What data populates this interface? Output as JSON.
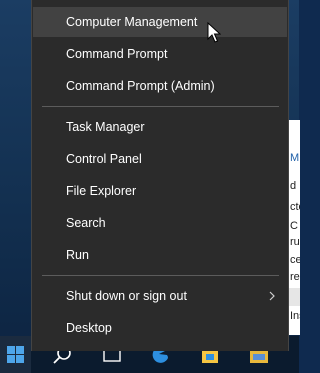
{
  "menu": {
    "items": [
      {
        "label": "Computer Management"
      },
      {
        "label": "Command Prompt"
      },
      {
        "label": "Command Prompt (Admin)"
      },
      {
        "label": "Task Manager"
      },
      {
        "label": "Control Panel"
      },
      {
        "label": "File Explorer"
      },
      {
        "label": "Search"
      },
      {
        "label": "Run"
      },
      {
        "label": "Shut down or sign out"
      },
      {
        "label": "Desktop"
      }
    ]
  },
  "background_window": {
    "fragments": [
      "M",
      "d",
      "cto",
      "C",
      "ru",
      "ce",
      "re",
      "Ins"
    ]
  },
  "colors": {
    "menu_bg": "#2b2b2b",
    "menu_hover": "#424242",
    "taskbar_bg": "#0b1b2e",
    "start_blue": "#4ea6ea"
  },
  "icons": {
    "start": "windows-logo-icon",
    "search": "search-icon",
    "task_view": "task-view-icon",
    "edge": "edge-browser-icon",
    "store": "store-icon",
    "file_explorer": "file-explorer-icon"
  }
}
